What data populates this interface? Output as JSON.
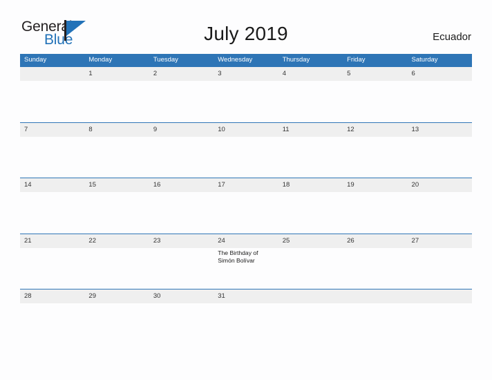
{
  "brand": {
    "word_one": "General",
    "word_two": "Blue",
    "mark_icon": "general-blue-triangle-icon",
    "dark_color": "#231f20",
    "blue_color": "#2272b8"
  },
  "header": {
    "title": "July 2019",
    "country": "Ecuador"
  },
  "theme": {
    "header_blue": "#2e75b6",
    "row_band_gray": "#efefef",
    "page_background": "#fdfdfe",
    "text_color": "#1a1a1a"
  },
  "calendar": {
    "month": "July",
    "year": "2019",
    "weekday_headers": [
      "Sunday",
      "Monday",
      "Tuesday",
      "Wednesday",
      "Thursday",
      "Friday",
      "Saturday"
    ],
    "weeks": [
      {
        "days": [
          {
            "num": "",
            "event": ""
          },
          {
            "num": "1",
            "event": ""
          },
          {
            "num": "2",
            "event": ""
          },
          {
            "num": "3",
            "event": ""
          },
          {
            "num": "4",
            "event": ""
          },
          {
            "num": "5",
            "event": ""
          },
          {
            "num": "6",
            "event": ""
          }
        ]
      },
      {
        "days": [
          {
            "num": "7",
            "event": ""
          },
          {
            "num": "8",
            "event": ""
          },
          {
            "num": "9",
            "event": ""
          },
          {
            "num": "10",
            "event": ""
          },
          {
            "num": "11",
            "event": ""
          },
          {
            "num": "12",
            "event": ""
          },
          {
            "num": "13",
            "event": ""
          }
        ]
      },
      {
        "days": [
          {
            "num": "14",
            "event": ""
          },
          {
            "num": "15",
            "event": ""
          },
          {
            "num": "16",
            "event": ""
          },
          {
            "num": "17",
            "event": ""
          },
          {
            "num": "18",
            "event": ""
          },
          {
            "num": "19",
            "event": ""
          },
          {
            "num": "20",
            "event": ""
          }
        ]
      },
      {
        "days": [
          {
            "num": "21",
            "event": ""
          },
          {
            "num": "22",
            "event": ""
          },
          {
            "num": "23",
            "event": ""
          },
          {
            "num": "24",
            "event": "The Birthday of Simón Bolívar"
          },
          {
            "num": "25",
            "event": ""
          },
          {
            "num": "26",
            "event": ""
          },
          {
            "num": "27",
            "event": ""
          }
        ]
      },
      {
        "days": [
          {
            "num": "28",
            "event": ""
          },
          {
            "num": "29",
            "event": ""
          },
          {
            "num": "30",
            "event": ""
          },
          {
            "num": "31",
            "event": ""
          },
          {
            "num": "",
            "event": ""
          },
          {
            "num": "",
            "event": ""
          },
          {
            "num": "",
            "event": ""
          }
        ]
      }
    ]
  }
}
